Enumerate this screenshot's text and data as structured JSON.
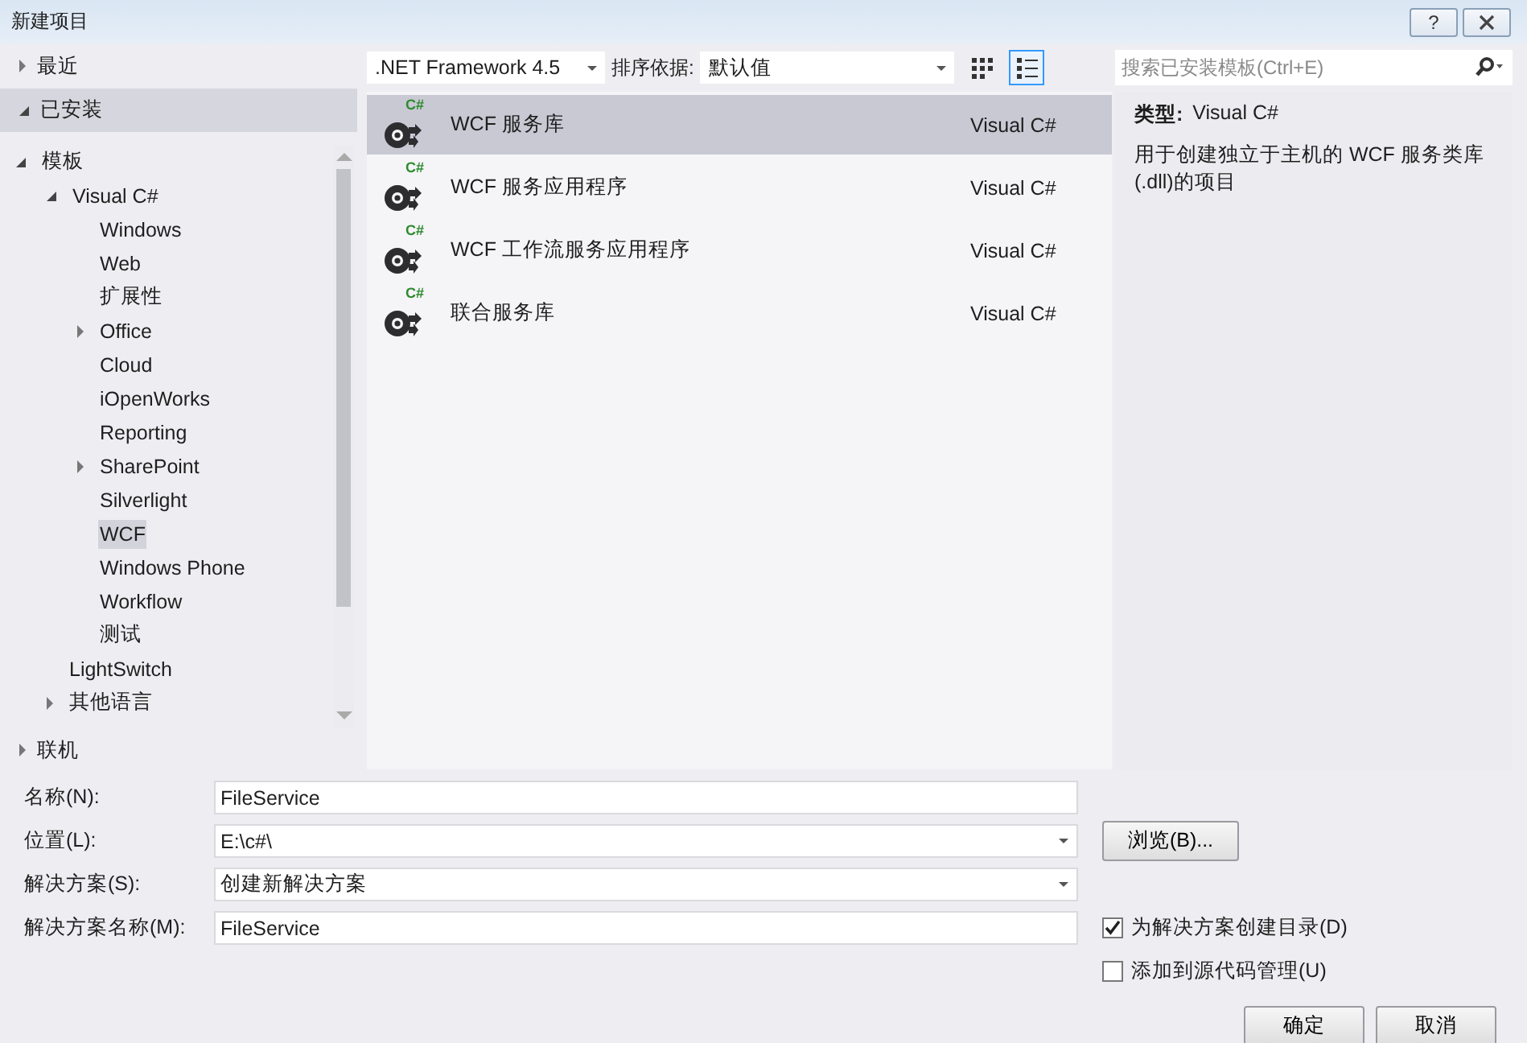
{
  "window": {
    "title": "新建项目",
    "help_button": "?"
  },
  "left_nav": [
    {
      "label": "最近",
      "expanded": false,
      "selected": false
    },
    {
      "label": "已安装",
      "expanded": true,
      "selected": true,
      "children": [
        {
          "label": "模板",
          "expanded": true,
          "selected": false,
          "children": [
            {
              "label": "Visual C#",
              "expanded": true,
              "selected": false,
              "children": [
                {
                  "label": "Windows",
                  "selected": false
                },
                {
                  "label": "Web",
                  "selected": false
                },
                {
                  "label": "扩展性",
                  "selected": false
                },
                {
                  "label": "Office",
                  "expanded": false,
                  "selected": false
                },
                {
                  "label": "Cloud",
                  "selected": false
                },
                {
                  "label": "iOpenWorks",
                  "selected": false
                },
                {
                  "label": "Reporting",
                  "selected": false
                },
                {
                  "label": "SharePoint",
                  "expanded": false,
                  "selected": false
                },
                {
                  "label": "Silverlight",
                  "selected": false
                },
                {
                  "label": "WCF",
                  "selected": true
                },
                {
                  "label": "Windows Phone",
                  "selected": false
                },
                {
                  "label": "Workflow",
                  "selected": false
                },
                {
                  "label": "测试",
                  "selected": false
                }
              ]
            },
            {
              "label": "LightSwitch",
              "selected": false
            },
            {
              "label": "其他语言",
              "expanded": false,
              "selected": false
            }
          ]
        }
      ]
    },
    {
      "label": "联机",
      "expanded": false,
      "selected": false
    }
  ],
  "toolbar": {
    "framework": ".NET Framework 4.5",
    "sort_label": "排序依据:",
    "sort_value": "默认值",
    "view_buttons": [
      {
        "kind": "grid",
        "selected": false
      },
      {
        "kind": "list",
        "selected": true
      }
    ]
  },
  "search": {
    "placeholder": "搜索已安装模板(Ctrl+E)"
  },
  "templates": [
    {
      "name": "WCF 服务库",
      "language": "Visual C#",
      "badge": "C#",
      "selected": true
    },
    {
      "name": "WCF 服务应用程序",
      "language": "Visual C#",
      "badge": "C#",
      "selected": false
    },
    {
      "name": "WCF 工作流服务应用程序",
      "language": "Visual C#",
      "badge": "C#",
      "selected": false
    },
    {
      "name": "联合服务库",
      "language": "Visual C#",
      "badge": "C#",
      "selected": false
    }
  ],
  "details": {
    "type_label": "类型:",
    "type_value": "Visual C#",
    "description": "用于创建独立于主机的 WCF 服务类库(.dll)的项目"
  },
  "form": {
    "fields": [
      {
        "label": "名称(N):",
        "value": "FileService",
        "kind": "text"
      },
      {
        "label": "位置(L):",
        "value": "E:\\c#\\",
        "kind": "dropdown"
      },
      {
        "label": "解决方案(S):",
        "value": "创建新解决方案",
        "kind": "dropdown"
      },
      {
        "label": "解决方案名称(M):",
        "value": "FileService",
        "kind": "text"
      }
    ],
    "browse_button": "浏览(B)...",
    "checkboxes": [
      {
        "label": "为解决方案创建目录(D)",
        "checked": true
      },
      {
        "label": "添加到源代码管理(U)",
        "checked": false
      }
    ]
  },
  "buttons": [
    "确定",
    "取消"
  ]
}
